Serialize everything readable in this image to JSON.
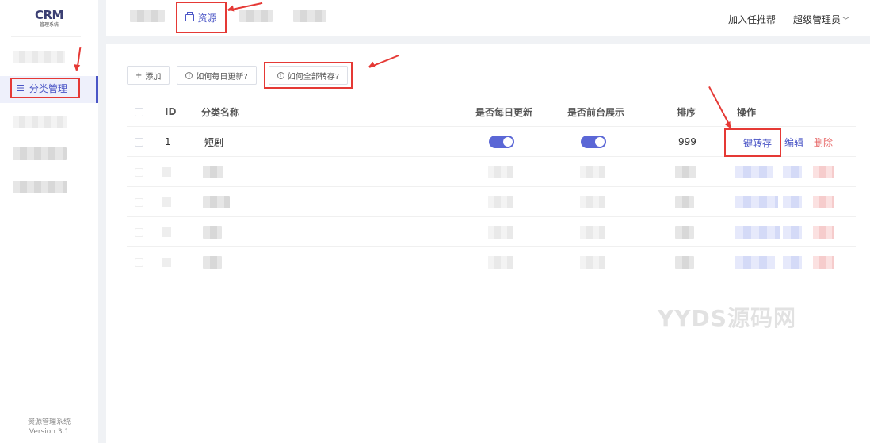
{
  "logo": {
    "mark": "CRM",
    "sub": "管理系统"
  },
  "sidebar": {
    "active_item": "分类管理",
    "footer_name": "资源管理系统",
    "footer_version": "Version 3.1"
  },
  "topbar": {
    "active_tab": "资源",
    "recommend": "加入任推帮",
    "user": "超级管理员"
  },
  "toolbar": {
    "add": "添加",
    "daily_update": "如何每日更新?",
    "transfer_all": "如何全部转存?"
  },
  "table": {
    "headers": {
      "id": "ID",
      "name": "分类名称",
      "daily": "是否每日更新",
      "front": "是否前台展示",
      "sort": "排序",
      "ops": "操作"
    },
    "rows": [
      {
        "id": "1",
        "name": "短剧",
        "daily_update": true,
        "front_display": true,
        "sort": "999",
        "op_transfer": "一键转存",
        "op_edit": "编辑",
        "op_delete": "删除"
      }
    ]
  },
  "watermark": "YYDS源码网",
  "colors": {
    "accent": "#4a55c6",
    "annotation": "#e53935",
    "danger": "#e66060"
  }
}
